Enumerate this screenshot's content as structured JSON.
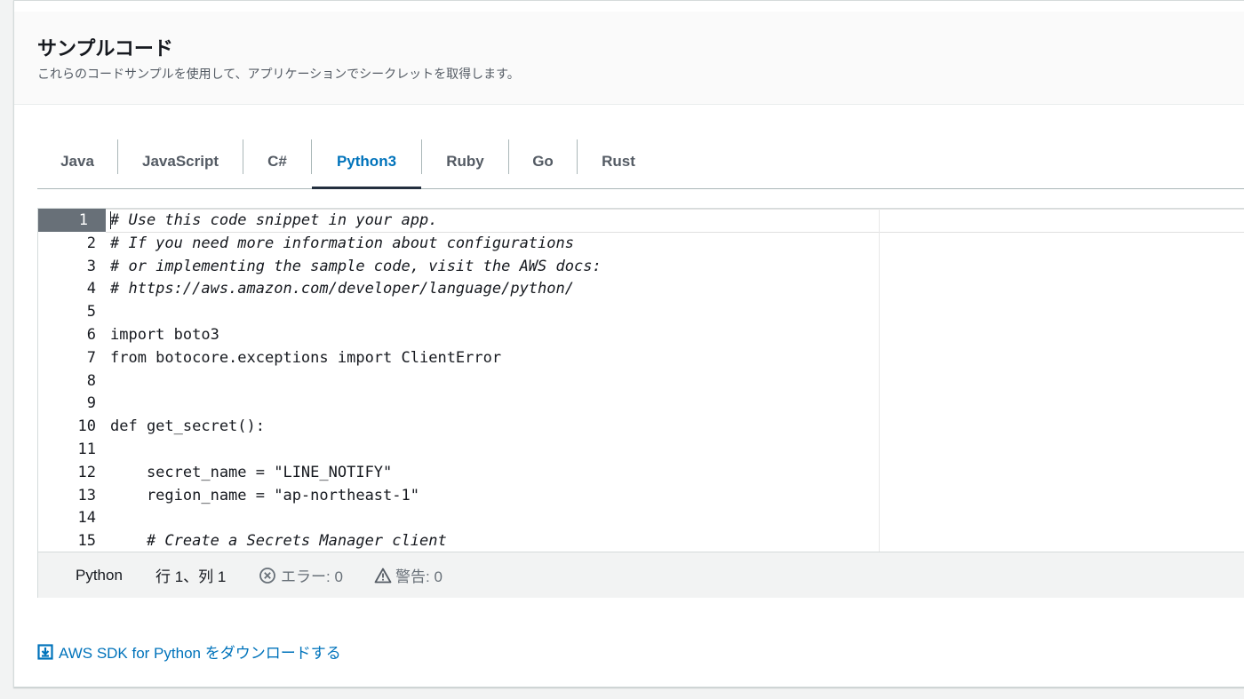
{
  "header": {
    "title": "サンプルコード",
    "subtitle": "これらのコードサンプルを使用して、アプリケーションでシークレットを取得します。"
  },
  "tabs": [
    {
      "label": "Java"
    },
    {
      "label": "JavaScript"
    },
    {
      "label": "C#"
    },
    {
      "label": "Python3",
      "active": true
    },
    {
      "label": "Ruby"
    },
    {
      "label": "Go"
    },
    {
      "label": "Rust"
    }
  ],
  "editor": {
    "lines": [
      {
        "num": "1",
        "text": "# Use this code snippet in your app."
      },
      {
        "num": "2",
        "text": "# If you need more information about configurations"
      },
      {
        "num": "3",
        "text": "# or implementing the sample code, visit the AWS docs:"
      },
      {
        "num": "4",
        "text": "# https://aws.amazon.com/developer/language/python/"
      },
      {
        "num": "5",
        "text": ""
      },
      {
        "num": "6",
        "text": "import boto3"
      },
      {
        "num": "7",
        "text": "from botocore.exceptions import ClientError"
      },
      {
        "num": "8",
        "text": ""
      },
      {
        "num": "9",
        "text": ""
      },
      {
        "num": "10",
        "text": "def get_secret():"
      },
      {
        "num": "11",
        "text": ""
      },
      {
        "num": "12",
        "text": "    secret_name = \"LINE_NOTIFY\""
      },
      {
        "num": "13",
        "text": "    region_name = \"ap-northeast-1\""
      },
      {
        "num": "14",
        "text": ""
      },
      {
        "num": "15",
        "text": "    # Create a Secrets Manager client"
      }
    ],
    "status": {
      "language": "Python",
      "position": "行 1、列 1",
      "errors": "エラー: 0",
      "warnings": "警告: 0"
    }
  },
  "download": {
    "label": "AWS SDK for Python をダウンロードする",
    "icon": "download-icon"
  },
  "colors": {
    "accent": "#0073bb",
    "active_tab_underline": "#232f3e",
    "gutter_active": "#687078"
  }
}
